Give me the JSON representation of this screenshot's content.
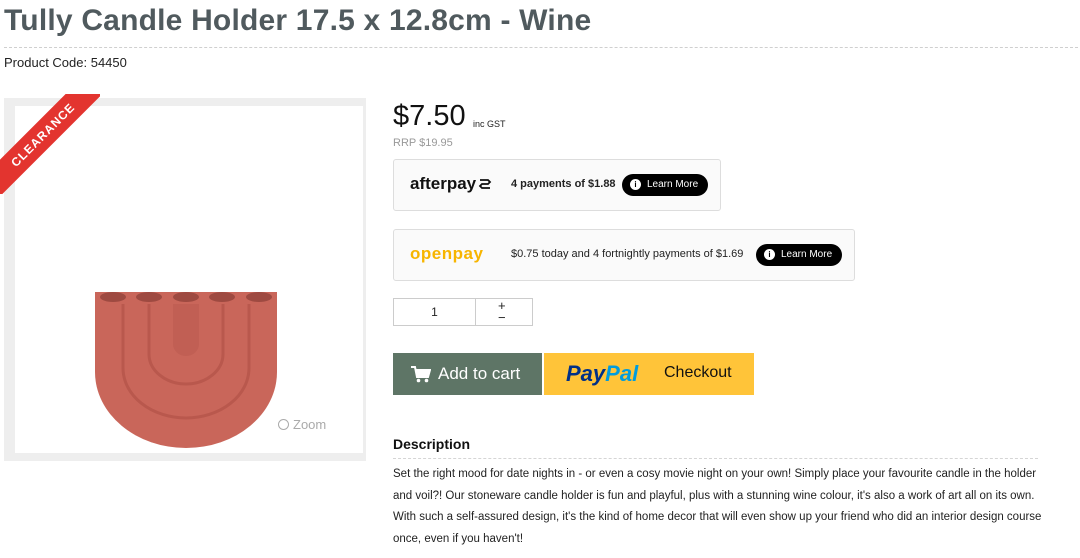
{
  "product": {
    "title": "Tully Candle Holder 17.5 x 12.8cm - Wine",
    "code_label": "Product Code: 54450"
  },
  "image": {
    "badge": "CLEARANCE",
    "zoom_label": "Zoom",
    "product_color": "#c9665a"
  },
  "pricing": {
    "price": "$7.50",
    "gst": "inc GST",
    "rrp": "RRP $19.95"
  },
  "afterpay": {
    "logo": "afterpay",
    "text": "4 payments of $1.88",
    "button": "Learn More"
  },
  "openpay": {
    "logo": "openpay",
    "text": "$0.75 today and 4 fortnightly payments of $1.69",
    "button": "Learn More"
  },
  "quantity": {
    "value": "1",
    "plus": "+",
    "minus": "−"
  },
  "actions": {
    "add_to_cart": "Add to cart",
    "paypal_p1": "Pay",
    "paypal_p2": "Pal",
    "paypal_checkout": "Checkout"
  },
  "description": {
    "heading": "Description",
    "body": "Set the right mood for date nights in - or even a cosy movie night on your own! Simply place your favourite candle in the holder and voil?! Our stoneware candle holder is fun and playful, plus with a stunning wine colour, it's also a work of art all on its own. With such a self-assured design, it's the kind of home decor that will even show up your friend who did an interior design course once, even if you haven't!"
  },
  "colors": {
    "title": "#505a5e",
    "cart_button": "#5e7566",
    "paypal_button": "#ffc439",
    "badge": "#e3342f",
    "openpay_logo": "#f7b500"
  }
}
